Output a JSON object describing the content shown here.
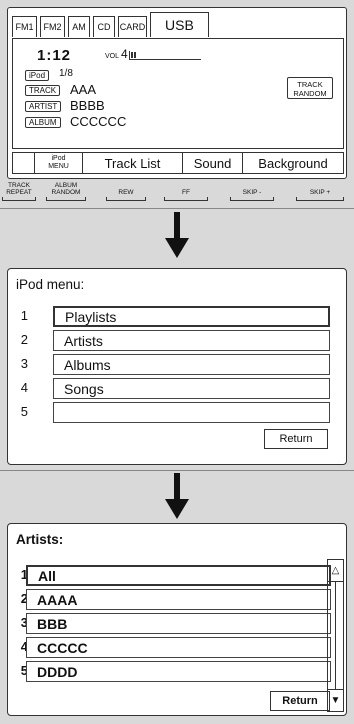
{
  "audio": {
    "source_tabs": [
      "FM1",
      "FM2",
      "AM",
      "CD",
      "CARD",
      "USB"
    ],
    "active_tab": "USB",
    "time": "1:12",
    "vol_label": "VOL",
    "vol_value": "4",
    "ipod_tag": "iPod",
    "ipod_count": "1/8",
    "track_tag": "TRACK",
    "track_value": "AAA",
    "artist_tag": "ARTIST",
    "artist_value": "BBBB",
    "album_tag": "ALBUM",
    "album_value": "CCCCCC",
    "track_random_line1": "TRACK",
    "track_random_line2": "RANDOM",
    "menu": {
      "ipod_menu_line1": "iPod",
      "ipod_menu_line2": "MENU",
      "track_list": "Track List",
      "sound": "Sound",
      "background": "Background"
    }
  },
  "softkeys": {
    "track_repeat_line1": "TRACK",
    "track_repeat_line2": "REPEAT",
    "album_random_line1": "ALBUM",
    "album_random_line2": "RANDOM",
    "rew": "REW",
    "ff": "FF",
    "skip_minus": "SKIP -",
    "skip_plus": "SKIP +"
  },
  "ipod_menu": {
    "title": "iPod menu:",
    "rows": [
      {
        "num": "1",
        "label": "Playlists"
      },
      {
        "num": "2",
        "label": "Artists"
      },
      {
        "num": "3",
        "label": "Albums"
      },
      {
        "num": "4",
        "label": "Songs"
      },
      {
        "num": "5",
        "label": ""
      }
    ],
    "return": "Return"
  },
  "artists": {
    "title": "Artists:",
    "rows": [
      {
        "num": "1",
        "label": "All"
      },
      {
        "num": "2",
        "label": "AAAA"
      },
      {
        "num": "3",
        "label": "BBB"
      },
      {
        "num": "4",
        "label": "CCCCC"
      },
      {
        "num": "5",
        "label": "DDDD"
      }
    ],
    "return": "Return"
  }
}
